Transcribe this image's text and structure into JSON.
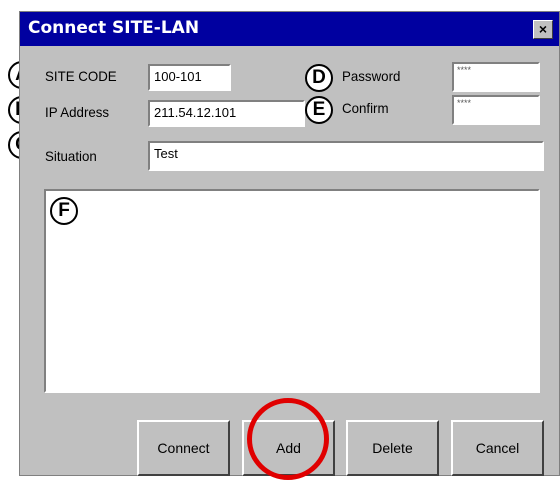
{
  "dialog": {
    "title": "Connect SITE-LAN",
    "close_label": "×"
  },
  "fields": {
    "site_code": {
      "label": "SITE CODE",
      "value": "100-101"
    },
    "ip_address": {
      "label": "IP Address",
      "value": "211.54.12.101"
    },
    "situation": {
      "label": "Situation",
      "value": "Test"
    },
    "password": {
      "label": "Password",
      "value": "****"
    },
    "confirm": {
      "label": "Confirm",
      "value": "****"
    }
  },
  "markers": {
    "a": "A",
    "b": "B",
    "c": "C",
    "d": "D",
    "e": "E",
    "f": "F"
  },
  "buttons": {
    "connect": "Connect",
    "add": "Add",
    "delete": "Delete",
    "cancel": "Cancel"
  },
  "colors": {
    "titlebar": "#0000a0",
    "highlight": "#e00000",
    "dialog_bg": "#c0c0c0"
  }
}
